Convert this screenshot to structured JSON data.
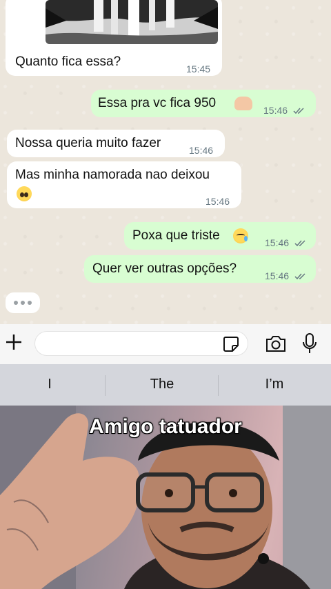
{
  "chat": {
    "image_message": {
      "text": "Quanto fica essa?",
      "time": "15:45"
    },
    "messages": [
      {
        "direction": "out",
        "text": "Essa pra vc fica 950",
        "emoji": "palms-up-together-icon",
        "time": "15:46",
        "read": true
      },
      {
        "direction": "in",
        "text": "Nossa queria muito fazer",
        "time": "15:46"
      },
      {
        "direction": "in",
        "text": "Mas minha namorada nao deixou",
        "emoji": "pleading-face-icon",
        "time": "15:46"
      },
      {
        "direction": "out",
        "text": "Poxa que triste",
        "emoji": "crying-face-icon",
        "time": "15:46",
        "read": true
      },
      {
        "direction": "out",
        "text": "Quer ver outras opções?",
        "time": "15:46",
        "read": true
      }
    ],
    "typing_indicator": "•••"
  },
  "input_bar": {
    "placeholder": ""
  },
  "keyboard": {
    "suggestions": [
      "I",
      "The",
      "I’m"
    ]
  },
  "video": {
    "caption": "Amigo tatuador"
  },
  "colors": {
    "outgoing": "#d8fdd2",
    "incoming": "#ffffff",
    "tick": "#667781"
  }
}
